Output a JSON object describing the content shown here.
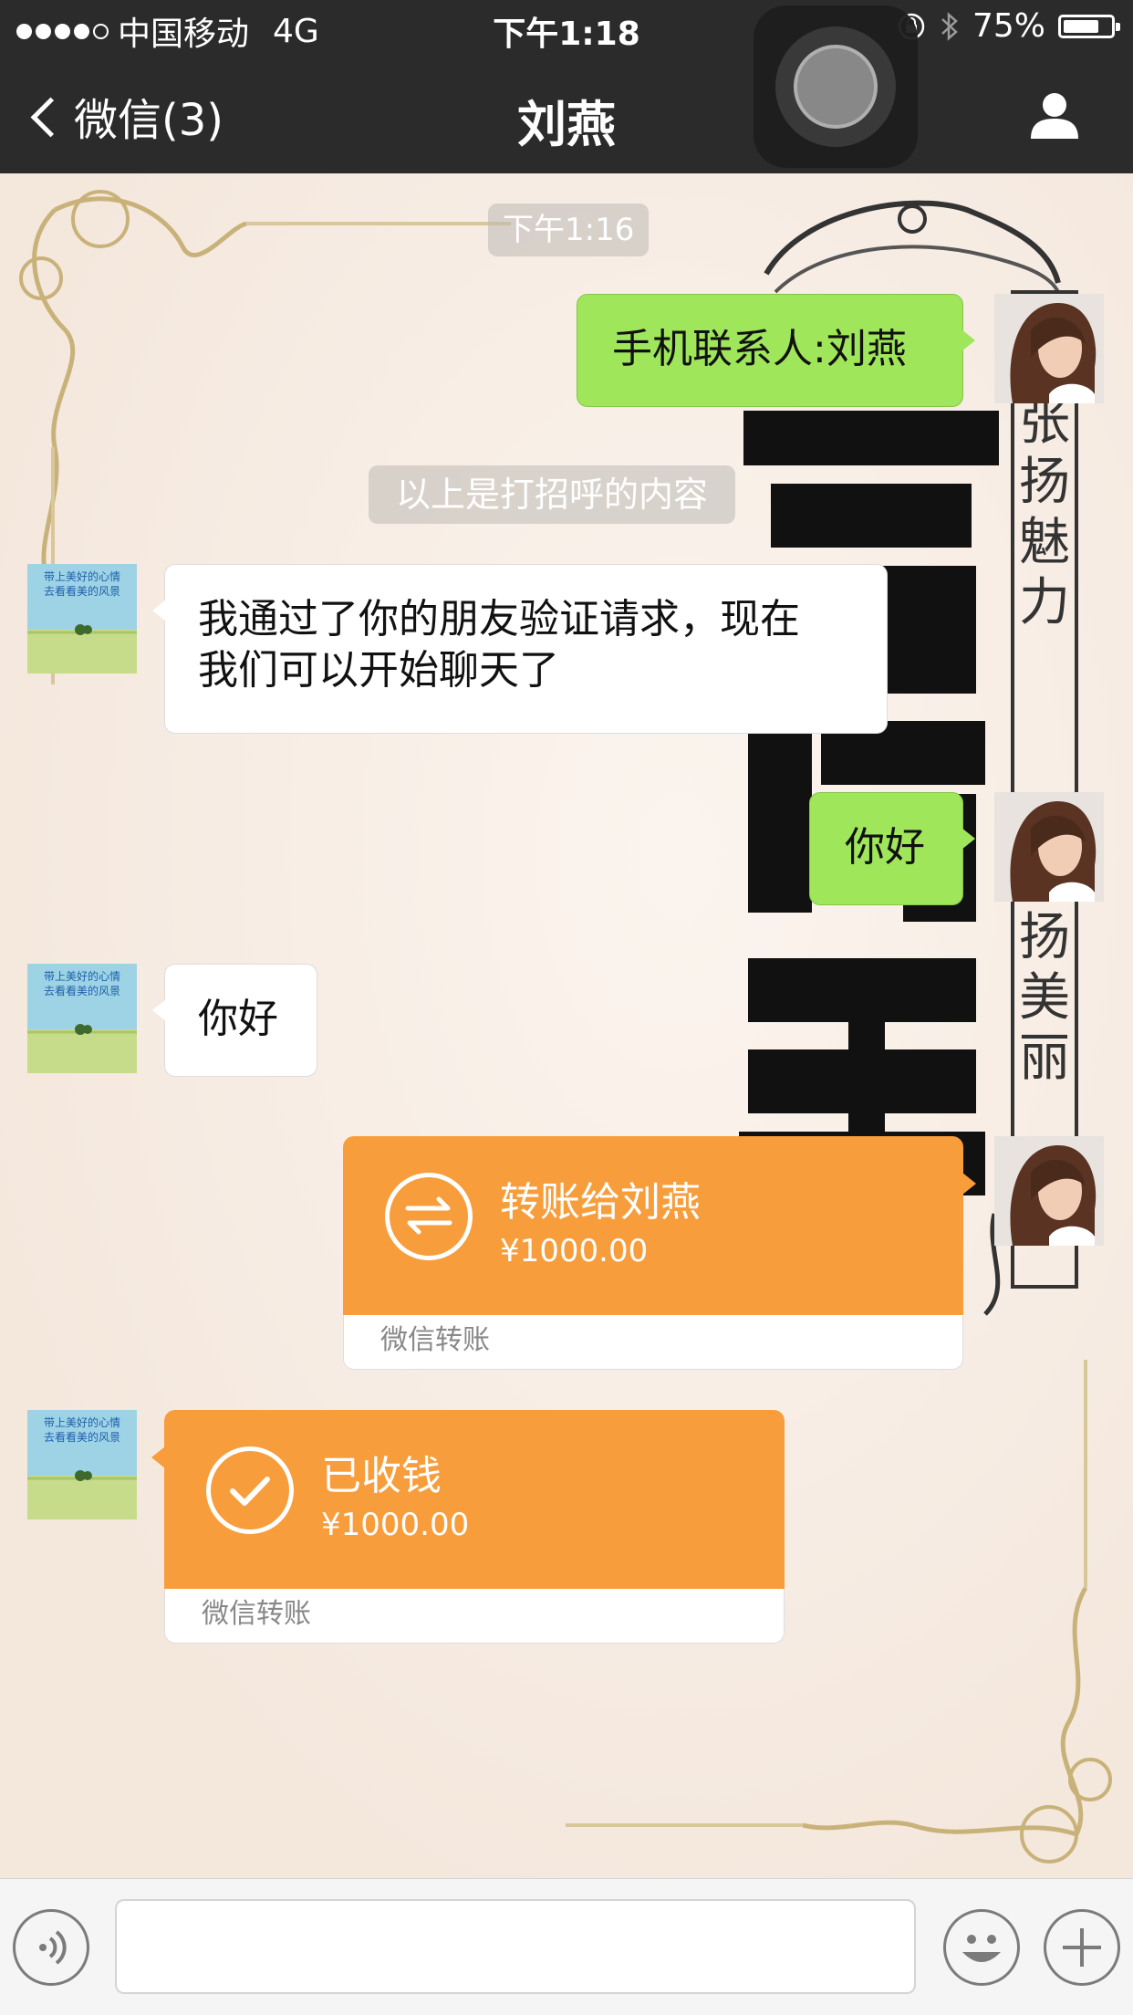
{
  "status_bar": {
    "carrier": "中国移动",
    "network": "4G",
    "time": "下午1:18",
    "battery_text": "75%",
    "battery_level": 0.75
  },
  "nav": {
    "back_label": "微信(3)",
    "title": "刘燕",
    "profile_icon": "person-icon"
  },
  "chat": {
    "timestamp": "下午1:16",
    "system_notice": "以上是打招呼的内容",
    "messages": [
      {
        "side": "right",
        "type": "text",
        "text": "手机联系人:刘燕"
      },
      {
        "side": "left",
        "type": "text",
        "lines": [
          "我通过了你的朋友验证请求，现在",
          "我们可以开始聊天了"
        ]
      },
      {
        "side": "right",
        "type": "text",
        "text": "你好"
      },
      {
        "side": "left",
        "type": "text",
        "text": "你好"
      },
      {
        "side": "right",
        "type": "transfer",
        "title": "转账给刘燕",
        "amount": "¥1000.00",
        "footer": "微信转账",
        "icon": "transfer-arrows-icon"
      },
      {
        "side": "left",
        "type": "transfer",
        "title": "已收钱",
        "amount": "¥1000.00",
        "footer": "微信转账",
        "icon": "checkmark-icon"
      }
    ]
  },
  "wallpaper": {
    "vertical_text_1": [
      "张",
      "扬",
      "魅",
      "力"
    ],
    "vertical_text_2": [
      "扬",
      "美",
      "丽"
    ]
  },
  "avatar_left_caption": [
    "带上美好的心情",
    "去看看美的风景"
  ],
  "input_bar": {
    "voice_icon": "voice-icon",
    "emoji_icon": "emoji-icon",
    "plus_icon": "plus-icon",
    "text_value": ""
  },
  "colors": {
    "bar_bg": "#2b2b2b",
    "bubble_green": "#9fe65b",
    "transfer_orange": "#f89d3b"
  }
}
